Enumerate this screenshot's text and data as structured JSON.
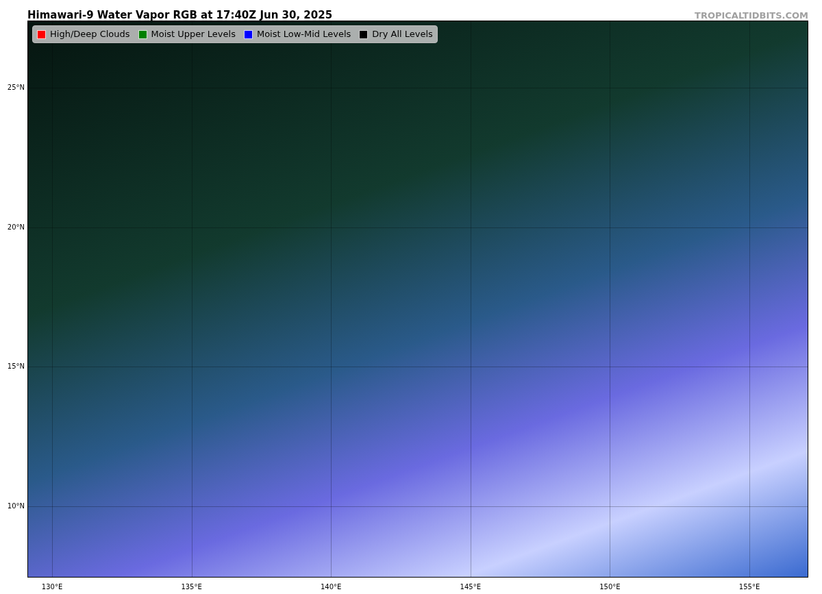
{
  "title": "Himawari-9 Water Vapor RGB at 17:40Z Jun 30, 2025",
  "credit": "TROPICALTIDBITS.COM",
  "legend": [
    {
      "label": "High/Deep Clouds",
      "color": "#ff0000"
    },
    {
      "label": "Moist Upper Levels",
      "color": "#008000"
    },
    {
      "label": "Moist Low-Mid Levels",
      "color": "#0000ff"
    },
    {
      "label": "Dry All Levels",
      "color": "#000000"
    }
  ],
  "map": {
    "latitude_labels": [
      "25°N",
      "20°N",
      "15°N",
      "10°N"
    ],
    "longitude_labels": [
      "130°E",
      "135°E",
      "140°E",
      "145°E",
      "150°E",
      "155°E"
    ]
  }
}
